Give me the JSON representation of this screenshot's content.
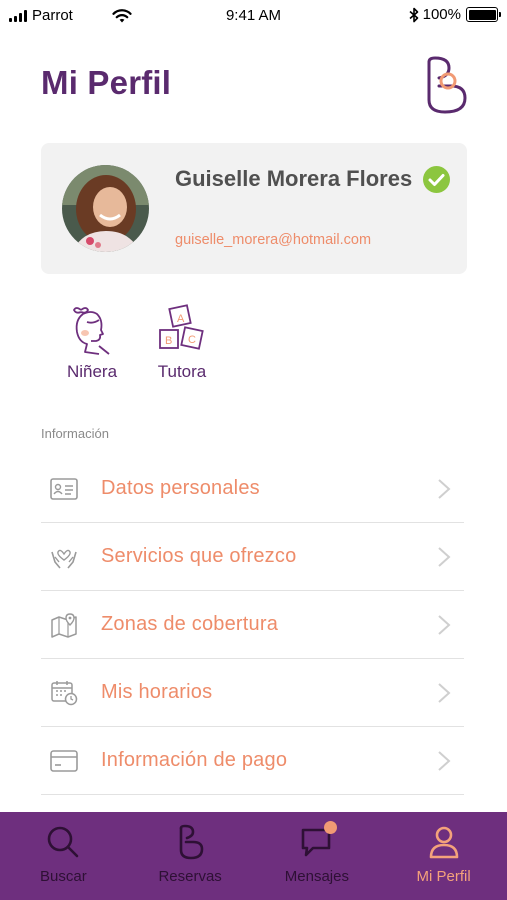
{
  "status_bar": {
    "carrier": "Parrot",
    "time": "9:41 AM",
    "battery": "100%"
  },
  "header": {
    "title": "Mi Perfil",
    "logo_icon": "brand-logo-icon"
  },
  "profile": {
    "name": "Guiselle Morera Flores",
    "email": "guiselle_morera@hotmail.com",
    "verified_icon": "check-circle-icon"
  },
  "roles": [
    {
      "label": "Niñera",
      "icon": "nanny-icon"
    },
    {
      "label": "Tutora",
      "icon": "abc-blocks-icon"
    }
  ],
  "section": {
    "label": "Información"
  },
  "menu": [
    {
      "label": "Datos personales",
      "icon": "id-card-icon"
    },
    {
      "label": "Servicios que ofrezco",
      "icon": "hands-heart-icon"
    },
    {
      "label": "Zonas de cobertura",
      "icon": "map-pin-icon"
    },
    {
      "label": "Mis horarios",
      "icon": "calendar-clock-icon"
    },
    {
      "label": "Información de pago",
      "icon": "credit-card-icon"
    }
  ],
  "tabs": [
    {
      "label": "Buscar",
      "icon": "search-icon"
    },
    {
      "label": "Reservas",
      "icon": "reservations-icon"
    },
    {
      "label": "Mensajes",
      "icon": "chat-icon"
    },
    {
      "label": "Mi Perfil",
      "icon": "person-icon",
      "active": true
    }
  ],
  "colors": {
    "brand_purple": "#5a2a6e",
    "tab_bar": "#6e2f7e",
    "accent_orange": "#ee8c6a",
    "verified_green": "#8cc63f"
  }
}
